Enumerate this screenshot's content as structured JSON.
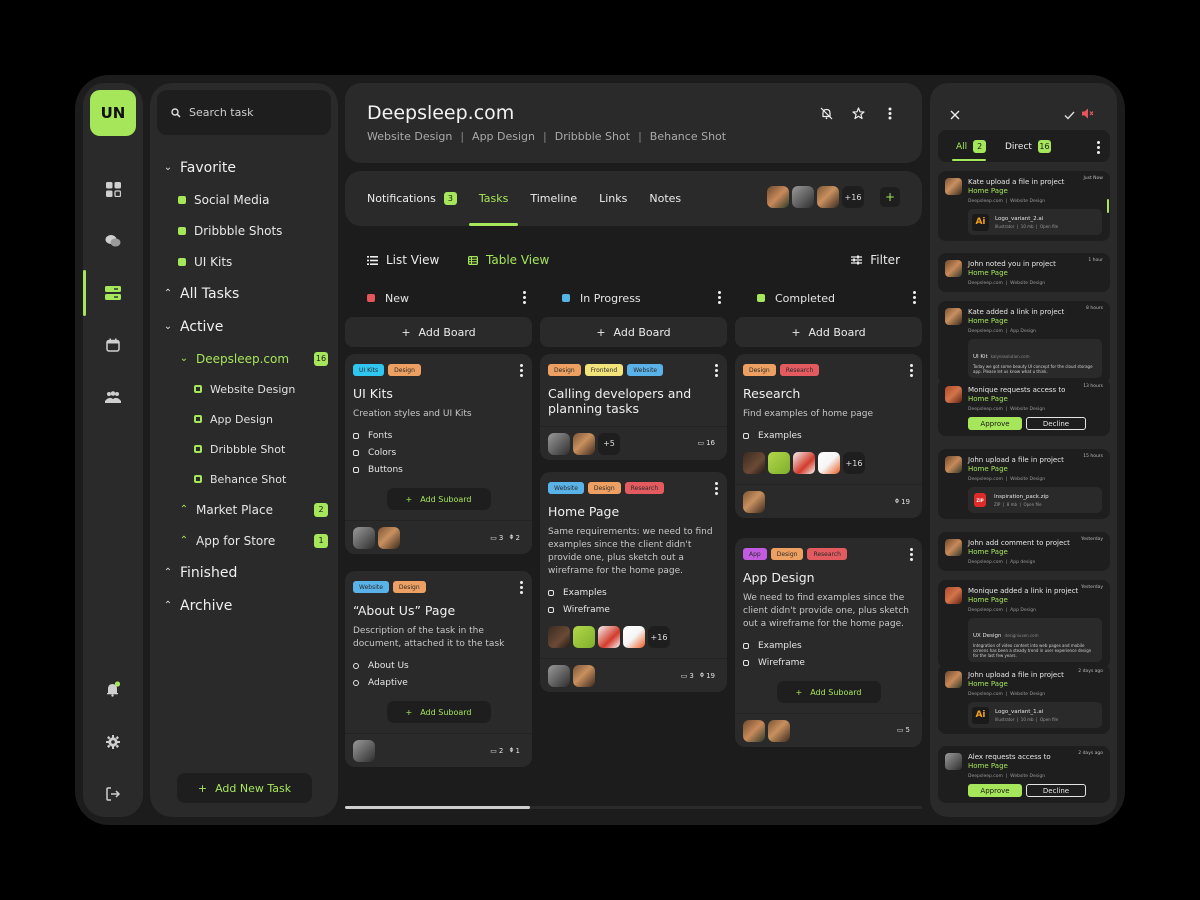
{
  "app": {
    "logo_initials": "UN",
    "accent": "#a5e65a"
  },
  "rail": {
    "icons": [
      "dashboard-icon",
      "chat-icon",
      "tasks-icon",
      "calendar-icon",
      "team-icon",
      "bell-icon",
      "gear-icon",
      "logout-icon"
    ],
    "active": "tasks-icon"
  },
  "sidebar": {
    "search_placeholder": "Search task",
    "favorite": {
      "label": "Favorite",
      "items": [
        "Social Media",
        "Dribbble Shots",
        "UI Kits"
      ]
    },
    "all_tasks": "All Tasks",
    "active": {
      "label": "Active",
      "projects": [
        {
          "label": "Deepsleep.com",
          "count": "16",
          "children": [
            "Website Design",
            "App Design",
            "Dribbble Shot",
            "Behance Shot"
          ]
        },
        {
          "label": "Market Place",
          "count": "2"
        },
        {
          "label": "App for Store",
          "count": "1"
        }
      ]
    },
    "finished": "Finished",
    "archive": "Archive",
    "add_task": "Add New Task"
  },
  "header": {
    "title": "Deepsleep.com",
    "breadcrumbs": [
      "Website Design",
      "App Design",
      "Dribbble Shot",
      "Behance Shot"
    ],
    "separator": "|"
  },
  "tabs": {
    "items": [
      {
        "label": "Notifications",
        "badge": "3"
      },
      {
        "label": "Tasks",
        "active": true
      },
      {
        "label": "Timeline"
      },
      {
        "label": "Links"
      },
      {
        "label": "Notes"
      }
    ],
    "members_more": "+16",
    "add": "+"
  },
  "views": {
    "list": "List View",
    "table": "Table View",
    "active": "Table View",
    "filter": "Filter"
  },
  "columns": [
    {
      "label": "New",
      "color": "#e5555a",
      "add_board": "Add Board"
    },
    {
      "label": "In Progress",
      "color": "#56b3e6",
      "add_board": "Add Board"
    },
    {
      "label": "Completed",
      "color": "#a5e65a",
      "add_board": "Add Board"
    }
  ],
  "tag_colors": {
    "UI Kits": "#2fc6f0",
    "Design": "#eda061",
    "Website": "#5ab3e8",
    "Frontend": "#f2e37b",
    "Research": "#e35a5f",
    "App": "#c25be0"
  },
  "cards": {
    "uikits": {
      "tags": [
        "UI Kits",
        "Design"
      ],
      "title": "UI Kits",
      "desc": "Creation styles and UI Kits",
      "checklist": [
        "Fonts",
        "Colors",
        "Buttons"
      ],
      "sub": "Add Suboard",
      "comments": "3",
      "attachments": "2"
    },
    "about": {
      "tags": [
        "Website",
        "Design"
      ],
      "title": "“About Us” Page",
      "desc": "Description of the task in the document, attached it to the task",
      "checklist": [
        "About Us",
        "Adaptive"
      ],
      "sub": "Add Suboard",
      "comments": "2",
      "attachments": "1"
    },
    "calling": {
      "tags": [
        "Design",
        "Frontend",
        "Website"
      ],
      "title": "Calling developers and planning tasks",
      "more_members": "+5",
      "comments": "16"
    },
    "home": {
      "tags": [
        "Website",
        "Design",
        "Research"
      ],
      "title": "Home Page",
      "desc": "Same requirements: we need to find examples since the client didn't provide one, plus sketch out a wireframe for the home page.",
      "checklist": [
        "Examples",
        "Wireframe"
      ],
      "more_images": "+16",
      "comments": "3",
      "attachments": "19"
    },
    "research": {
      "tags": [
        "Design",
        "Research"
      ],
      "title": "Research",
      "desc": "Find examples of home page",
      "checklist": [
        "Examples"
      ],
      "more_images": "+16",
      "attachments": "19"
    },
    "appdesign": {
      "tags": [
        "App",
        "Design",
        "Research"
      ],
      "title": "App Design",
      "desc": "We need to find examples since the client didn't provide one, plus sketch out a wireframe for the home page.",
      "checklist": [
        "Examples",
        "Wireframe"
      ],
      "sub": "Add Suboard",
      "comments": "5"
    }
  },
  "board_scroll": {
    "visible_fraction": 0.32
  },
  "notifications": {
    "tabs": [
      {
        "label": "All",
        "count": "2",
        "active": true
      },
      {
        "label": "Direct",
        "count": "16"
      }
    ],
    "items": [
      {
        "user": "Kate",
        "action": "upload a file in project",
        "target": "Home Page",
        "project": "Deepsleep.com",
        "category": "Website Design",
        "time": "Just Now",
        "file": {
          "name": "Logo_variant_2.ai",
          "type": "Illustrator",
          "size": "10 mb",
          "action": "Open file",
          "icon": "Ai"
        }
      },
      {
        "user": "John",
        "action": "noted you in project",
        "target": "Home Page",
        "project": "Deepsleep.com",
        "category": "Website Design",
        "time": "1 hour"
      },
      {
        "user": "Kate",
        "action": "added a link in project",
        "target": "Home Page",
        "project": "Deepsleep.com",
        "category": "App Design",
        "time": "8 hours",
        "link": {
          "title": "UI Kit",
          "url": "kalynasolution.com",
          "body": "Today we got some beauty UI concept for the cloud storage app. Please let us know what u think."
        }
      },
      {
        "user": "Monique",
        "action": "requests access to",
        "target": "Home Page",
        "project": "Deepsleep.com",
        "category": "Website Design",
        "time": "13 hours",
        "approve": "Approve",
        "decline": "Decline"
      },
      {
        "user": "John",
        "action": "upload a file in project",
        "target": "Home Page",
        "project": "Deepsleep.com",
        "category": "Website Design",
        "time": "15 hours",
        "file": {
          "name": "Inspiration_pack.zip",
          "type": "ZIP",
          "size": "8 mb",
          "action": "Open file",
          "icon": "ZIP"
        }
      },
      {
        "user": "John",
        "action": "add comment to project",
        "target": "Home Page",
        "project": "Deepsleep.com",
        "category": "App design",
        "time": "Yesterday"
      },
      {
        "user": "Monique",
        "action": "added a link in project",
        "target": "Home Page",
        "project": "Deepsleep.com",
        "category": "App Design",
        "time": "Yesterday",
        "link": {
          "title": "UX Design",
          "url": "designiuxen.com",
          "body": "Integration of video content into web pages and mobile screens has been a steady trend in user experience design for the last few years."
        }
      },
      {
        "user": "John",
        "action": "upload a file in project",
        "target": "Home Page",
        "project": "Deepsleep.com",
        "category": "Website Design",
        "time": "2 days ago",
        "file": {
          "name": "Logo_variant_1.ai",
          "type": "Illustrator",
          "size": "10 mb",
          "action": "Open file",
          "icon": "Ai"
        }
      },
      {
        "user": "Alex",
        "action": "requests access to",
        "target": "Home Page",
        "project": "Deepsleep.com",
        "category": "Website Design",
        "time": "2 days ago",
        "approve": "Approve",
        "decline": "Decline"
      }
    ]
  }
}
